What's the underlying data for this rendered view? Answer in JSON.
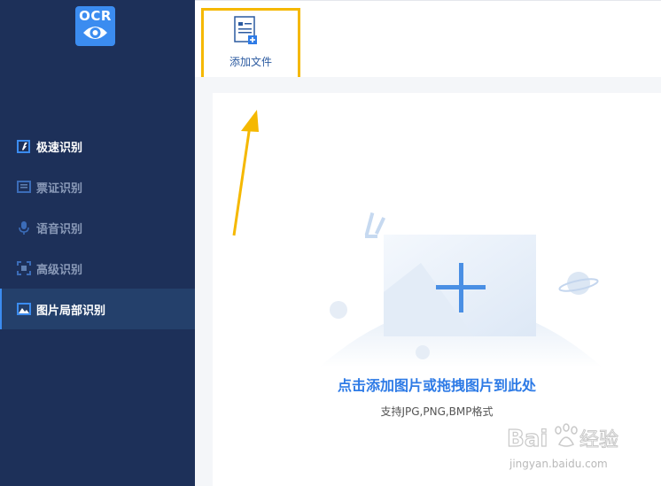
{
  "logo": {
    "text": "OCR",
    "icon": "eye-icon"
  },
  "sidebar": {
    "items": [
      {
        "label": "极速识别",
        "icon": "fast-recognize-icon",
        "active": false
      },
      {
        "label": "票证识别",
        "icon": "ticket-icon",
        "active": false
      },
      {
        "label": "语音识别",
        "icon": "microphone-icon",
        "active": false
      },
      {
        "label": "高级识别",
        "icon": "scan-frame-icon",
        "active": false
      },
      {
        "label": "图片局部识别",
        "icon": "image-icon",
        "active": true
      }
    ]
  },
  "toolbar": {
    "add_file_label": "添加文件",
    "add_file_icon": "add-document-icon"
  },
  "dropzone": {
    "title": "点击添加图片或拖拽图片到此处",
    "subtitle": "支持JPG,PNG,BMP格式"
  },
  "watermark": {
    "url": "jingyan.baidu.com"
  },
  "colors": {
    "sidebar": "#1d3059",
    "accent": "#2e7be6",
    "highlight": "#f5b800"
  }
}
